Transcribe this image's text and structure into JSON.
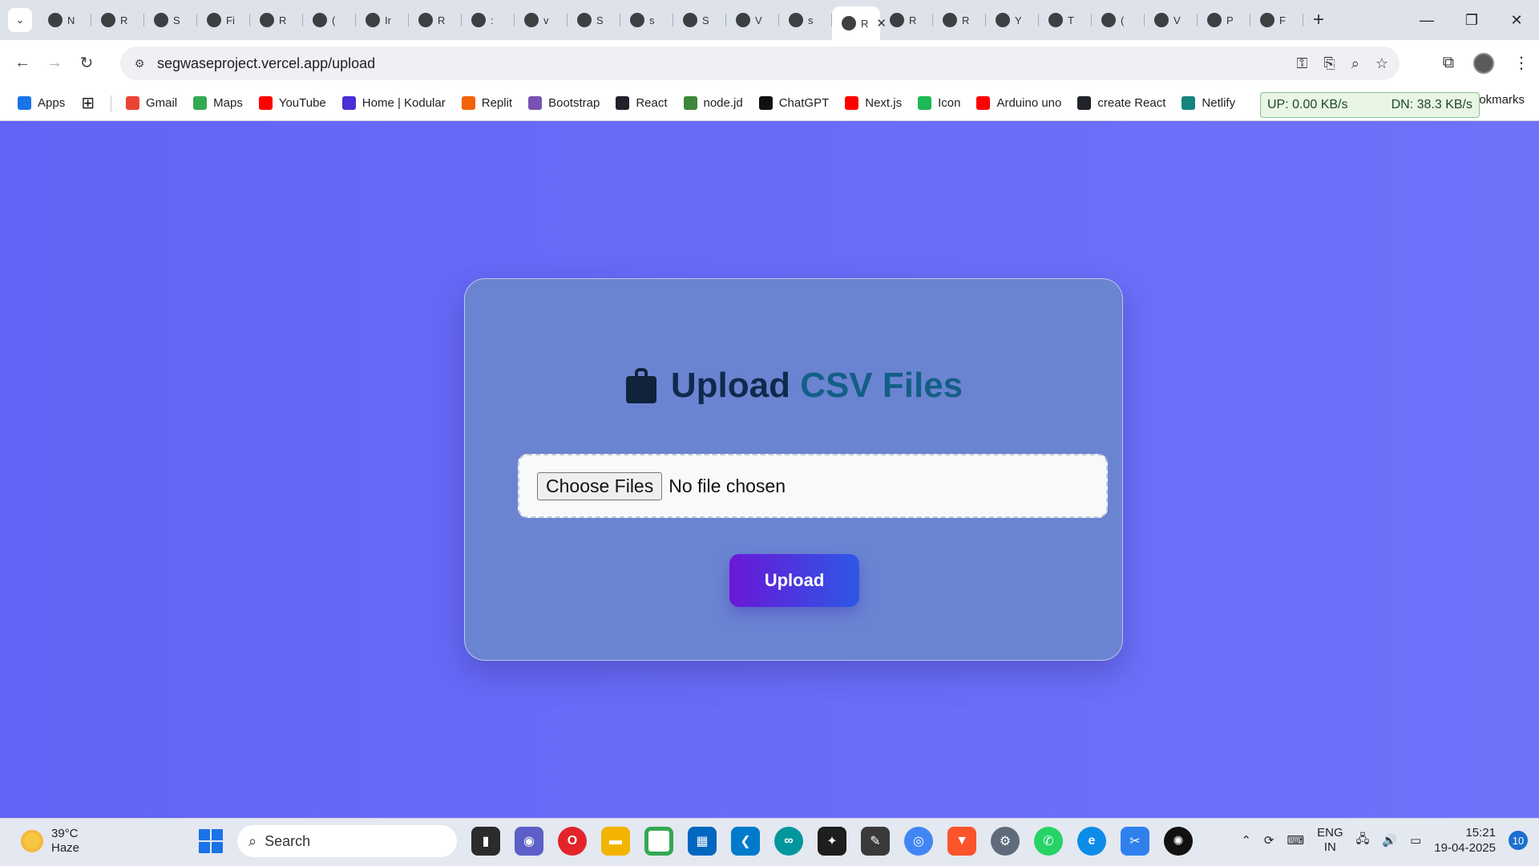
{
  "tabs": [
    {
      "icon": "github-icon",
      "label": "N"
    },
    {
      "icon": "react-icon",
      "label": "R"
    },
    {
      "icon": "gmail-icon",
      "label": "S"
    },
    {
      "icon": "docs-icon",
      "label": "Fi"
    },
    {
      "icon": "react-icon",
      "label": "R"
    },
    {
      "icon": "linkedin-icon",
      "label": "("
    },
    {
      "icon": "infosys-icon",
      "label": "Ir"
    },
    {
      "icon": "react-icon",
      "label": "R"
    },
    {
      "icon": "google-icon",
      "label": ":"
    },
    {
      "icon": "github-icon",
      "label": "v"
    },
    {
      "icon": "render-icon",
      "label": "S"
    },
    {
      "icon": "globe-icon",
      "label": "s"
    },
    {
      "icon": "github-icon",
      "label": "S"
    },
    {
      "icon": "openai-icon",
      "label": "V"
    },
    {
      "icon": "vercel-icon",
      "label": "s"
    },
    {
      "icon": "page-icon",
      "label": "R",
      "active": true
    },
    {
      "icon": "react-icon",
      "label": "R"
    },
    {
      "icon": "react-icon",
      "label": "R"
    },
    {
      "icon": "link-icon",
      "label": "Y"
    },
    {
      "icon": "s-icon",
      "label": "T"
    },
    {
      "icon": "linkedin-icon",
      "label": "("
    },
    {
      "icon": "globe-icon",
      "label": "V"
    },
    {
      "icon": "globe-icon",
      "label": "P"
    },
    {
      "icon": "globe-icon",
      "label": "F"
    }
  ],
  "omnibox": {
    "url": "segwaseproject.vercel.app/upload"
  },
  "bookmarks": [
    {
      "label": "Apps",
      "color": "#1a73e8"
    },
    {
      "label": "Gmail",
      "color": "#ea4335"
    },
    {
      "label": "Maps",
      "color": "#34a853"
    },
    {
      "label": "YouTube",
      "color": "#ff0000"
    },
    {
      "label": "Home | Kodular",
      "color": "#4b2ed6"
    },
    {
      "label": "Replit",
      "color": "#f26207"
    },
    {
      "label": "Bootstrap",
      "color": "#7952b3"
    },
    {
      "label": "React",
      "color": "#20232a"
    },
    {
      "label": "node.jd",
      "color": "#3c873a"
    },
    {
      "label": "ChatGPT",
      "color": "#111111"
    },
    {
      "label": "Next.js",
      "color": "#ff0000"
    },
    {
      "label": "Icon",
      "color": "#1db954"
    },
    {
      "label": "Arduino uno",
      "color": "#ff0000"
    },
    {
      "label": "create React",
      "color": "#20232a"
    },
    {
      "label": "Netlify",
      "color": "#15847d"
    }
  ],
  "bookmarks_more": "okmarks",
  "netmon": {
    "up": "UP: 0.00 KB/s",
    "down": "DN: 38.3 KB/s"
  },
  "page": {
    "title_part1": "Upload",
    "title_part2": "CSV Files",
    "choose_button": "Choose Files",
    "file_status": "No file chosen",
    "upload_button": "Upload"
  },
  "taskbar": {
    "temperature": "39°C",
    "condition": "Haze",
    "search_placeholder": "Search",
    "lang_top": "ENG",
    "lang_bottom": "IN",
    "time": "15:21",
    "date": "19-04-2025",
    "notifications": "10"
  }
}
